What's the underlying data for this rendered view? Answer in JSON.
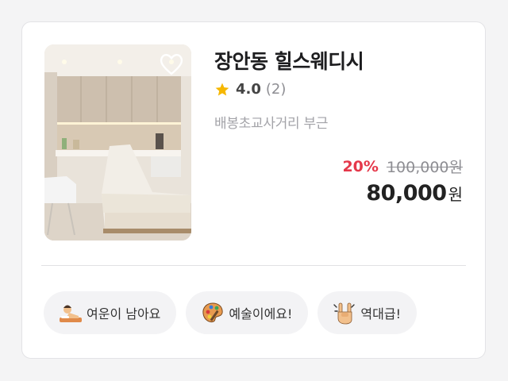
{
  "listing": {
    "title": "장안동 힐스웨디시",
    "rating": "4.0",
    "review_count": "(2)",
    "location": "배봉초교사거리 부근",
    "discount": "20%",
    "original_price": "100,000원",
    "final_price": "80,000",
    "final_price_unit": "원",
    "favorite": false
  },
  "tags": [
    {
      "label": "여운이 남아요",
      "icon": "relaxing-person-icon"
    },
    {
      "label": "예술이에요!",
      "icon": "palette-icon"
    },
    {
      "label": "역대급!",
      "icon": "rock-hand-icon"
    }
  ],
  "colors": {
    "discount": "#e5384a",
    "star": "#f6b700",
    "tag_background": "#f3f3f5"
  }
}
